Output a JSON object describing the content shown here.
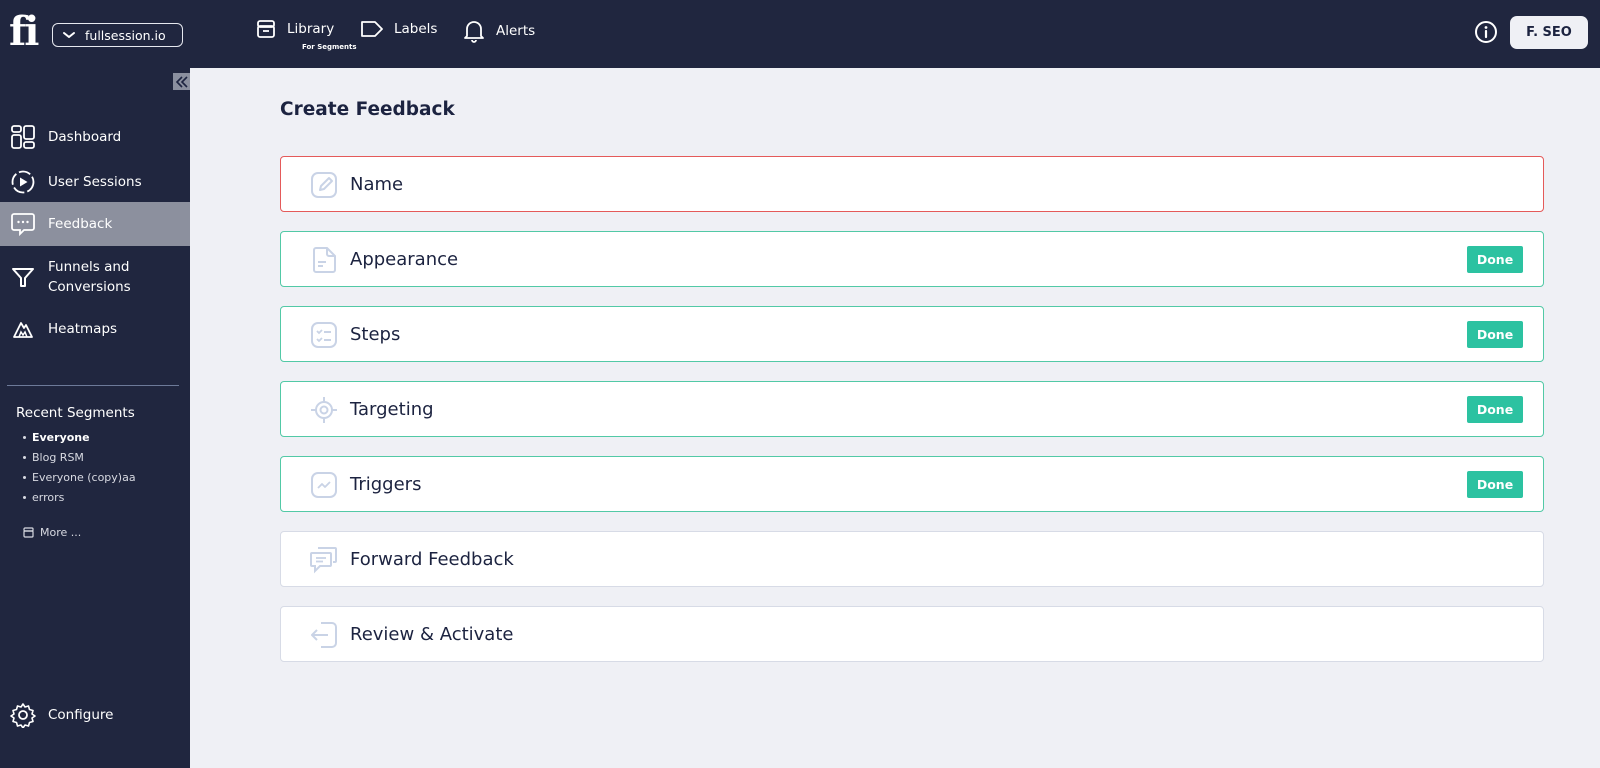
{
  "topbar": {
    "logo": "fi",
    "workspace": "fullsession.io",
    "nav": [
      {
        "label": "Library",
        "sublabel": "For Segments",
        "icon": "archive-icon"
      },
      {
        "label": "Labels",
        "icon": "label-icon"
      },
      {
        "label": "Alerts",
        "icon": "bell-icon"
      }
    ],
    "user": "F. SEO"
  },
  "sidebar": {
    "items": [
      {
        "label": "Dashboard",
        "icon": "dashboard-icon"
      },
      {
        "label": "User Sessions",
        "icon": "play-icon"
      },
      {
        "label": "Feedback",
        "icon": "chat-icon",
        "active": true
      },
      {
        "label": "Funnels and Conversions",
        "line1": "Funnels and",
        "line2": "Conversions",
        "icon": "funnel-icon"
      },
      {
        "label": "Heatmaps",
        "icon": "heatmap-icon"
      }
    ],
    "recent_title": "Recent Segments",
    "segments": [
      "Everyone",
      "Blog RSM",
      "Everyone (copy)aa",
      "errors"
    ],
    "more_label": "More ...",
    "configure_label": "Configure"
  },
  "main": {
    "title": "Create Feedback",
    "steps": [
      {
        "title": "Name",
        "status": "error",
        "icon": "edit-icon"
      },
      {
        "title": "Appearance",
        "status": "done",
        "icon": "document-icon"
      },
      {
        "title": "Steps",
        "status": "done",
        "icon": "checklist-icon"
      },
      {
        "title": "Targeting",
        "status": "done",
        "icon": "target-icon"
      },
      {
        "title": "Triggers",
        "status": "done",
        "icon": "trend-icon"
      },
      {
        "title": "Forward Feedback",
        "status": "pending",
        "icon": "messages-icon"
      },
      {
        "title": "Review & Activate",
        "status": "pending",
        "icon": "login-icon"
      }
    ],
    "done_label": "Done"
  },
  "colors": {
    "navy": "#20263f",
    "done_green": "#2cc2a1",
    "error_red": "#e45a5a",
    "background": "#eff0f5"
  }
}
